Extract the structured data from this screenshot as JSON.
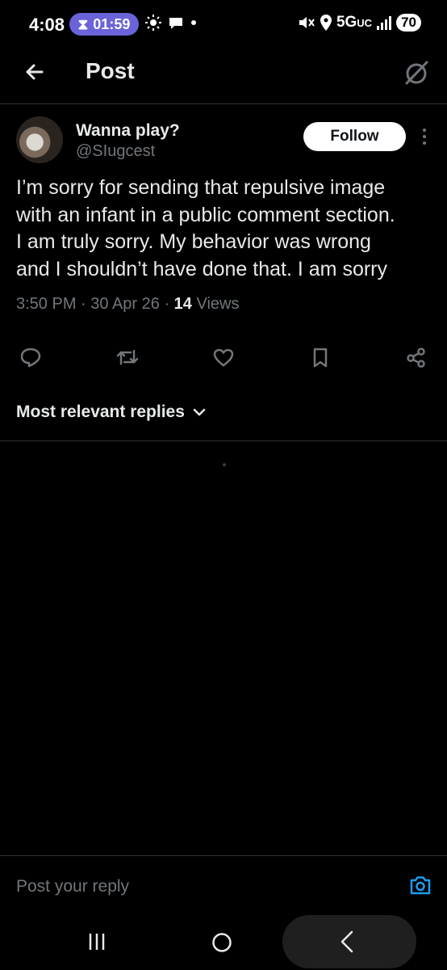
{
  "status_bar": {
    "time": "4:08",
    "timer": "01:59",
    "network": "5G",
    "network_suffix": "UC",
    "battery": "70"
  },
  "header": {
    "title": "Post"
  },
  "post": {
    "display_name": "Wanna play?",
    "handle": "@SIugcest",
    "follow_label": "Follow",
    "text": "I’m sorry for sending that repulsive  image\nwith an infant in a public comment section.\nI am truly sorry. My behavior was wrong\nand I shouldn’t have done that. I am sorry",
    "time": "3:50 PM",
    "date": "30 Apr 26",
    "views_count": "14",
    "views_label": "Views"
  },
  "replies": {
    "sort_label": "Most relevant replies"
  },
  "reply_bar": {
    "placeholder": "Post your reply"
  },
  "colors": {
    "background": "#000000",
    "text_primary": "#e7e9ea",
    "text_secondary": "#71767b",
    "accent": "#1d9bf0",
    "timer_pill": "#6b63d9"
  },
  "icons": {
    "back": "arrow-left-icon",
    "grok": "grok-icon",
    "reply": "speech-bubble-icon",
    "repost": "repost-icon",
    "like": "heart-icon",
    "bookmark": "bookmark-icon",
    "share": "share-nodes-icon",
    "camera": "camera-icon"
  }
}
